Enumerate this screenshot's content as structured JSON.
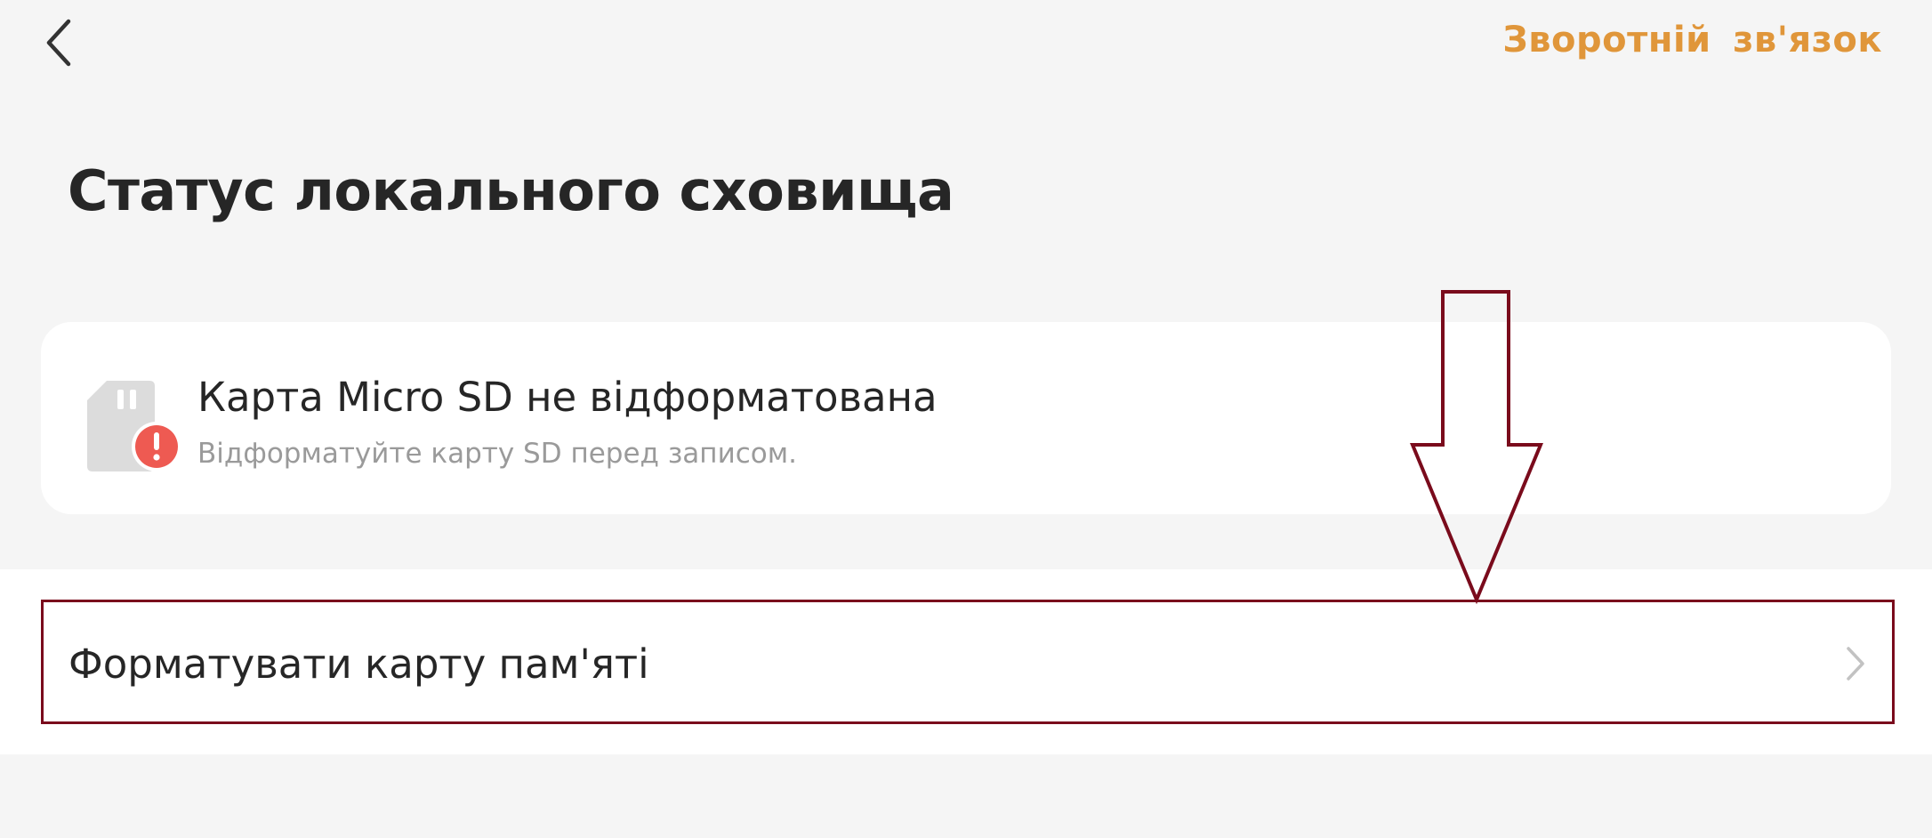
{
  "header": {
    "back_icon": "chevron-left-icon",
    "feedback_label": "Зворотній зв'язок"
  },
  "page": {
    "title": "Статус локального сховища"
  },
  "status_card": {
    "icon": "sd-card-error-icon",
    "title": "Карта Micro SD не відформатована",
    "subtitle": "Відформатуйте карту SD перед записом."
  },
  "actions": {
    "format_label": "Форматувати карту пам'яті",
    "chevron_icon": "chevron-right-icon"
  },
  "colors": {
    "accent": "#e0963a",
    "error": "#ee5a52",
    "annotation": "#7a0b1c",
    "background": "#f5f5f5"
  }
}
